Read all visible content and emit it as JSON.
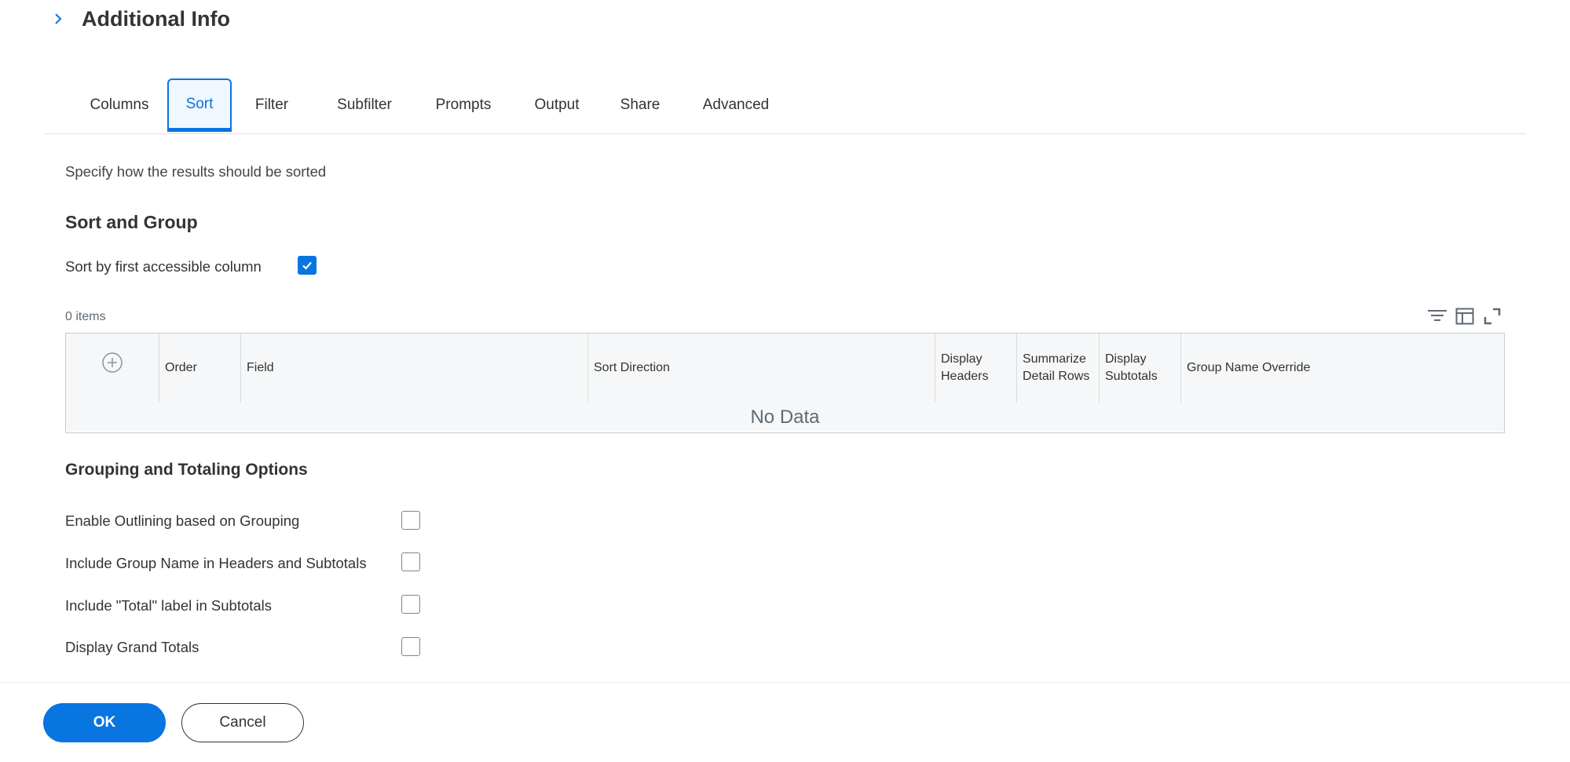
{
  "header": {
    "title": "Additional Info"
  },
  "tabs": [
    {
      "label": "Columns",
      "active": false
    },
    {
      "label": "Sort",
      "active": true
    },
    {
      "label": "Filter",
      "active": false
    },
    {
      "label": "Subfilter",
      "active": false
    },
    {
      "label": "Prompts",
      "active": false
    },
    {
      "label": "Output",
      "active": false
    },
    {
      "label": "Share",
      "active": false
    },
    {
      "label": "Advanced",
      "active": false
    }
  ],
  "sort": {
    "description": "Specify how the results should be sorted",
    "heading": "Sort and Group",
    "first_column_label": "Sort by first accessible column",
    "first_column_checked": true,
    "items_count": "0 items",
    "table": {
      "columns": [
        "Order",
        "Field",
        "Sort Direction",
        "Display Headers",
        "Summarize Detail Rows",
        "Display Subtotals",
        "Group Name Override"
      ],
      "empty_text": "No Data"
    },
    "toolbar_icons": [
      "filter-icon",
      "column-layout-icon",
      "fullscreen-icon"
    ]
  },
  "grouping": {
    "heading": "Grouping and Totaling Options",
    "options": [
      {
        "label": "Enable Outlining based on Grouping",
        "checked": false
      },
      {
        "label": "Include Group Name in Headers and Subtotals",
        "checked": false
      },
      {
        "label": "Include \"Total\" label in Subtotals",
        "checked": false
      },
      {
        "label": "Display Grand Totals",
        "checked": false
      }
    ]
  },
  "footer": {
    "ok_label": "OK",
    "cancel_label": "Cancel"
  },
  "colors": {
    "accent": "#0875e1",
    "text": "#333333",
    "muted": "#5e6a75"
  }
}
